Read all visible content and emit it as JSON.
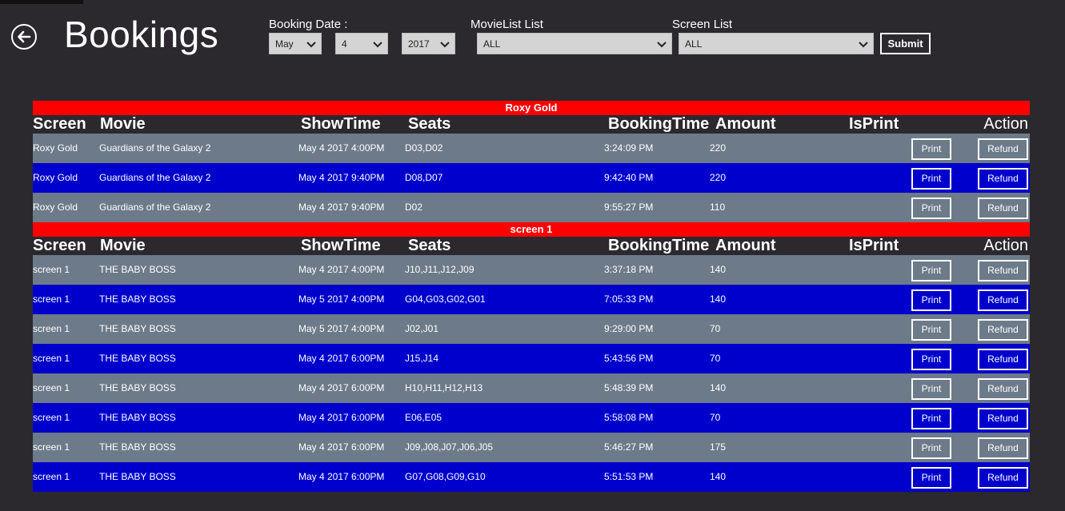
{
  "page": {
    "title": "Bookings"
  },
  "filters": {
    "booking_date_label": "Booking Date :",
    "month": "May",
    "day": "4",
    "year": "2017",
    "movie_list_label": "MovieList List",
    "movie_value": "ALL",
    "screen_list_label": "Screen List",
    "screen_value": "ALL",
    "submit_label": "Submit"
  },
  "columns": {
    "screen": "Screen",
    "movie": "Movie",
    "showtime": "ShowTime",
    "seats": "Seats",
    "bookingtime": "BookingTime",
    "amount": "Amount",
    "isprint": "IsPrint",
    "action": "Action"
  },
  "buttons": {
    "print": "Print",
    "refund": "Refund"
  },
  "colors": {
    "group_header": "#ff0000",
    "row_gray": "#6d7a89",
    "row_blue": "#0000cc",
    "background": "#2b292e"
  },
  "groups": [
    {
      "name": "Roxy Gold",
      "rows": [
        {
          "screen": "Roxy Gold",
          "movie": "Guardians of the Galaxy 2",
          "showtime": "May  4 2017 4:00PM",
          "seats": "D03,D02",
          "bookingtime": "3:24:09 PM",
          "amount": "220"
        },
        {
          "screen": "Roxy Gold",
          "movie": "Guardians of the Galaxy 2",
          "showtime": "May  4 2017 9:40PM",
          "seats": "D08,D07",
          "bookingtime": "9:42:40 PM",
          "amount": "220"
        },
        {
          "screen": "Roxy Gold",
          "movie": "Guardians of the Galaxy 2",
          "showtime": "May  4 2017 9:40PM",
          "seats": "D02",
          "bookingtime": "9:55:27 PM",
          "amount": "110"
        }
      ]
    },
    {
      "name": "screen 1",
      "rows": [
        {
          "screen": "screen 1",
          "movie": "THE BABY BOSS",
          "showtime": "May  4 2017 4:00PM",
          "seats": "J10,J11,J12,J09",
          "bookingtime": "3:37:18 PM",
          "amount": "140"
        },
        {
          "screen": "screen 1",
          "movie": "THE BABY BOSS",
          "showtime": "May  5 2017 4:00PM",
          "seats": "G04,G03,G02,G01",
          "bookingtime": "7:05:33 PM",
          "amount": "140"
        },
        {
          "screen": "screen 1",
          "movie": "THE BABY BOSS",
          "showtime": "May  5 2017 4:00PM",
          "seats": "J02,J01",
          "bookingtime": "9:29:00 PM",
          "amount": "70"
        },
        {
          "screen": "screen 1",
          "movie": "THE BABY BOSS",
          "showtime": "May  4 2017 6:00PM",
          "seats": "J15,J14",
          "bookingtime": "5:43:56 PM",
          "amount": "70"
        },
        {
          "screen": "screen 1",
          "movie": "THE BABY BOSS",
          "showtime": "May  4 2017 6:00PM",
          "seats": "H10,H11,H12,H13",
          "bookingtime": "5:48:39 PM",
          "amount": "140"
        },
        {
          "screen": "screen 1",
          "movie": "THE BABY BOSS",
          "showtime": "May  4 2017 6:00PM",
          "seats": "E06,E05",
          "bookingtime": "5:58:08 PM",
          "amount": "70"
        },
        {
          "screen": "screen 1",
          "movie": "THE BABY BOSS",
          "showtime": "May  4 2017 6:00PM",
          "seats": "J09,J08,J07,J06,J05",
          "bookingtime": "5:46:27 PM",
          "amount": "175"
        },
        {
          "screen": "screen 1",
          "movie": "THE BABY BOSS",
          "showtime": "May  4 2017 6:00PM",
          "seats": "G07,G08,G09,G10",
          "bookingtime": "5:51:53 PM",
          "amount": "140"
        }
      ]
    }
  ]
}
